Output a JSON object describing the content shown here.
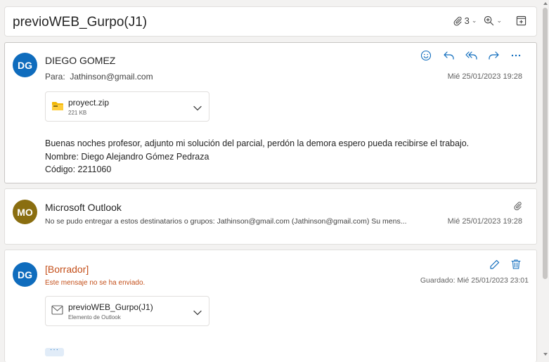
{
  "conversation": {
    "subject": "previoWEB_Gurpo(J1)",
    "attachment_count": "3",
    "icons": [
      "paperclip-icon",
      "zoom-icon",
      "open-window-icon"
    ]
  },
  "messages": [
    {
      "avatar": "DG",
      "avatar_color": "#0f6cbd",
      "sender": "DIEGO GOMEZ",
      "to_label": "Para:",
      "to": "Jathinson@gmail.com",
      "date": "Mié 25/01/2023 19:28",
      "actions": [
        "smiley-icon",
        "reply-icon",
        "reply-all-icon",
        "forward-icon",
        "more-icon"
      ],
      "attachment": {
        "name": "proyect.zip",
        "size": "221 KB",
        "icon": "zip-folder-icon"
      },
      "body": [
        "Buenas noches profesor, adjunto mi solución del parcial, perdón la demora espero pueda recibirse el trabajo.",
        "Nombre: Diego Alejandro Gómez Pedraza",
        "Código: 2211060"
      ]
    },
    {
      "avatar": "MO",
      "avatar_color": "#8a6e10",
      "sender": "Microsoft Outlook",
      "preview": "No se pudo entregar a estos destinatarios o grupos: Jathinson@gmail.com (Jathinson@gmail.com) Su mens...",
      "date": "Mié 25/01/2023 19:28"
    },
    {
      "avatar": "DG",
      "avatar_color": "#0f6cbd",
      "sender": "[Borrador]",
      "notice": "Este mensaje no se ha enviado.",
      "date": "Guardado: Mié 25/01/2023 23:01",
      "actions": [
        "edit-icon",
        "delete-icon"
      ],
      "attachment": {
        "name": "previoWEB_Gurpo(J1)",
        "type": "Elemento de Outlook",
        "icon": "mail-item-icon"
      },
      "more": "···"
    }
  ],
  "colors": {
    "accent": "#0f6cbd",
    "draft": "#c4501b"
  }
}
